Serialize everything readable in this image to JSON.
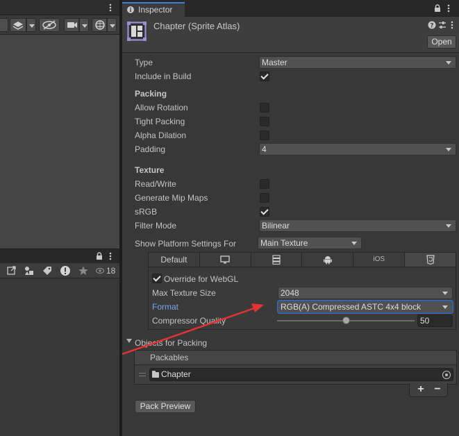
{
  "left_panel": {
    "bottom_count": "18"
  },
  "inspector": {
    "tab_label": "Inspector",
    "asset_title": "Chapter (Sprite Atlas)",
    "open_label": "Open",
    "type_label": "Type",
    "type_value": "Master",
    "include_label": "Include in Build",
    "include_checked": true,
    "packing": {
      "heading": "Packing",
      "allow_rotation": "Allow Rotation",
      "tight_packing": "Tight Packing",
      "alpha_dilation": "Alpha Dilation",
      "padding_label": "Padding",
      "padding_value": "4"
    },
    "texture": {
      "heading": "Texture",
      "read_write": "Read/Write",
      "generate_mip_maps": "Generate Mip Maps",
      "srgb": "sRGB",
      "filter_mode_label": "Filter Mode",
      "filter_mode_value": "Bilinear"
    },
    "platform": {
      "show_label": "Show Platform Settings For",
      "show_value": "Main Texture",
      "tabs": [
        "Default",
        "",
        "",
        "",
        "iOS",
        ""
      ],
      "tab_icons": [
        "",
        "monitor-icon",
        "server-icon",
        "android-icon",
        "",
        "html5-icon"
      ],
      "override_label": "Override for WebGL",
      "max_texture_label": "Max Texture Size",
      "max_texture_value": "2048",
      "format_label": "Format",
      "format_value": "RGB(A) Compressed ASTC 4x4 block",
      "compressor_label": "Compressor Quality",
      "compressor_value": "50",
      "compressor_level": 0.5
    },
    "objects": {
      "heading": "Objects for Packing",
      "packables_label": "Packables",
      "item": "Chapter",
      "add": "+",
      "remove": "−"
    },
    "pack_preview": "Pack Preview"
  },
  "colors": {
    "accent_tab": "#3a7fd8",
    "format_link": "#7aa7e6",
    "annotation_arrow": "#e53232"
  }
}
